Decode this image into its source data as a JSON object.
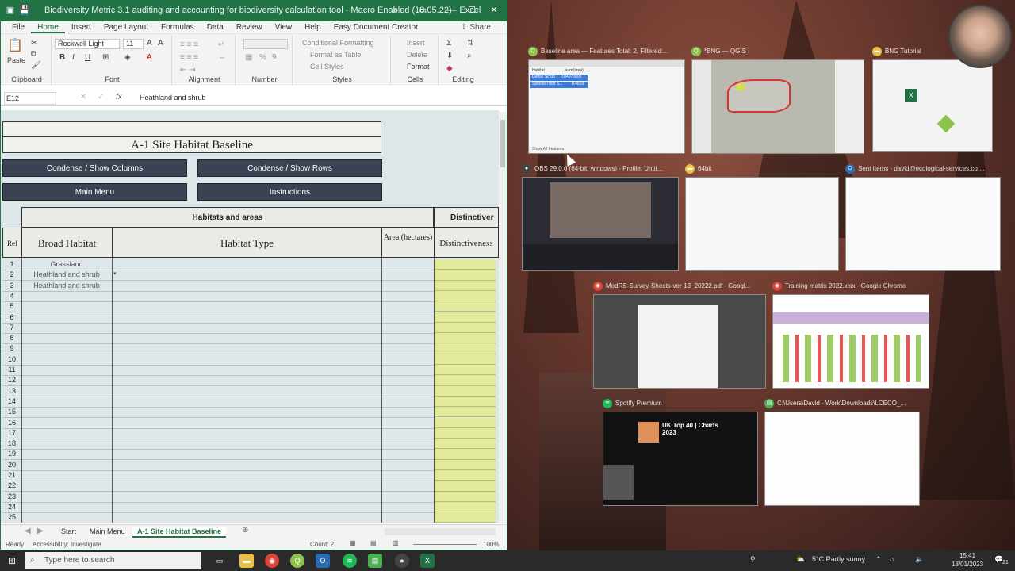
{
  "excel": {
    "title": "Biodiversity Metric 3.1 auditing and accounting for biodiversity calculation tool - Macro Enabled (18.05.22)  -  Excel",
    "tabs": [
      "File",
      "Home",
      "Insert",
      "Page Layout",
      "Formulas",
      "Data",
      "Review",
      "View",
      "Help",
      "Easy Document Creator"
    ],
    "active_tab": "Home",
    "share_label": "Share",
    "ribbon": {
      "clipboard": "Clipboard",
      "paste": "Paste",
      "font": "Font",
      "font_name": "Rockwell Light",
      "font_size": "11",
      "alignment": "Alignment",
      "number": "Number",
      "styles": "Styles",
      "conditional_formatting": "Conditional Formatting",
      "format_as_table": "Format as Table",
      "cell_styles": "Cell Styles",
      "cells": "Cells",
      "insert": "Insert",
      "delete": "Delete",
      "format": "Format",
      "editing": "Editing"
    },
    "name_box": "E12",
    "formula_value": "Heathland and shrub",
    "sheet": {
      "title": "A-1 Site Habitat Baseline",
      "btn_condense_cols": "Condense / Show Columns",
      "btn_condense_rows": "Condense / Show Rows",
      "btn_main_menu": "Main Menu",
      "btn_instructions": "Instructions",
      "group_header": "Habitats and areas",
      "group_header2": "Distinctiver",
      "col_ref": "Ref",
      "col_broad": "Broad Habitat",
      "col_type": "Habitat Type",
      "col_area": "Area (hectares)",
      "col_dist": "Distinctiveness",
      "rows": [
        {
          "ref": "1",
          "broad": "Grassland"
        },
        {
          "ref": "2",
          "broad": "Heathland and shrub"
        },
        {
          "ref": "3",
          "broad": "Heathland and shrub"
        },
        {
          "ref": "4",
          "broad": ""
        },
        {
          "ref": "5",
          "broad": ""
        },
        {
          "ref": "6",
          "broad": ""
        },
        {
          "ref": "7",
          "broad": ""
        },
        {
          "ref": "8",
          "broad": ""
        },
        {
          "ref": "9",
          "broad": ""
        },
        {
          "ref": "10",
          "broad": ""
        },
        {
          "ref": "11",
          "broad": ""
        },
        {
          "ref": "12",
          "broad": ""
        },
        {
          "ref": "13",
          "broad": ""
        },
        {
          "ref": "14",
          "broad": ""
        },
        {
          "ref": "15",
          "broad": ""
        },
        {
          "ref": "16",
          "broad": ""
        },
        {
          "ref": "17",
          "broad": ""
        },
        {
          "ref": "18",
          "broad": ""
        },
        {
          "ref": "19",
          "broad": ""
        },
        {
          "ref": "20",
          "broad": ""
        },
        {
          "ref": "21",
          "broad": ""
        },
        {
          "ref": "22",
          "broad": ""
        },
        {
          "ref": "23",
          "broad": ""
        },
        {
          "ref": "24",
          "broad": ""
        },
        {
          "ref": "25",
          "broad": ""
        }
      ]
    },
    "sheet_tabs": [
      "Start",
      "Main Menu",
      "A-1 Site Habitat Baseline"
    ],
    "status": {
      "ready": "Ready",
      "accessibility": "Accessibility: Investigate",
      "count": "Count: 2",
      "zoom": "100%"
    }
  },
  "task_view": {
    "windows": [
      {
        "id": "qgis-table",
        "title": "Baseline area — Features Total: 2, Filtered:...",
        "icon_color": "#8bc34a"
      },
      {
        "id": "qgis-map",
        "title": "*BNG — QGIS",
        "icon_color": "#8bc34a"
      },
      {
        "id": "bng-tutorial",
        "title": "BNG Tutorial",
        "icon_color": "#e8c04a"
      },
      {
        "id": "obs",
        "title": "OBS 29.0.0 (64-bit, windows) - Profile: Untit...",
        "icon_color": "#444444"
      },
      {
        "id": "64bit",
        "title": "64bit",
        "icon_color": "#e8c04a"
      },
      {
        "id": "outlook",
        "title": "Sent Items - david@ecological-services.co....",
        "icon_color": "#2b6cb0"
      },
      {
        "id": "chrome-pdf",
        "title": "ModRS-Survey-Sheets-ver-13_20222.pdf - Googl...",
        "icon_color": "#db4437"
      },
      {
        "id": "chrome-xlsx",
        "title": "Training matrix 2022.xlsx - Google Chrome",
        "icon_color": "#db4437"
      },
      {
        "id": "spotify",
        "title": "Spotify Premium",
        "icon_color": "#1db954"
      },
      {
        "id": "explorer",
        "title": "C:\\Users\\David - Work\\Downloads\\LCECO_...",
        "icon_color": "#4caf50"
      }
    ],
    "qgis_table": {
      "col1": "Habitat",
      "col2": "sum(area)",
      "r1a": "Dense Scrub",
      "r1b": "0.04970000",
      "r2a": "Species Poor S...",
      "r2b": "0.4833",
      "footer": "Show All Features"
    },
    "spotify": {
      "headline": "UK Top 40 | Charts 2023"
    }
  },
  "taskbar": {
    "search_placeholder": "Type here to search",
    "weather": "5°C  Partly sunny",
    "time": "15:41",
    "date": "18/01/2023",
    "notif_count": "21"
  }
}
